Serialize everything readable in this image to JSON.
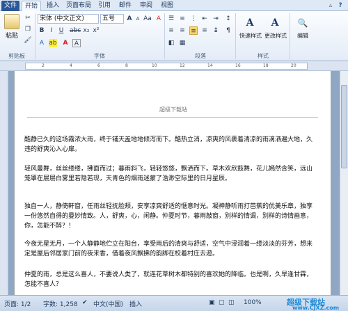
{
  "tabs": [
    "文件",
    "开始",
    "插入",
    "页面布局",
    "引用",
    "邮件",
    "审阅",
    "视图"
  ],
  "ribbon": {
    "paste_label": "粘贴",
    "clipboard_label": "剪贴板",
    "font_name": "宋体 (中文正文)",
    "font_size": "五号",
    "font_group_label": "字体",
    "paragraph_group_label": "段落",
    "styles_group_label": "样式",
    "quick_style_label": "快速样式",
    "change_style_label": "更改样式",
    "edit_label": "编辑"
  },
  "document": {
    "header": "超级下载站",
    "paragraphs": [
      "酷静已久的这场霧浓大雨，终于铺天盖地地倾泻而下。酷热立消，凉爽的风裹着清凉的雨滴洒遍大地，久违的舒爽沁入心扉。",
      "轻风曼舞，丝丝缕缕，拂面而过；暮雨斜飞，轻轻悠悠，飘洒而下。草木欢欣鼓舞，花儿嫣然含笑，远山笼罩在层层白雾里若隐若现，天青色的烟雨迷蒙了浩渺空际里的日月星辰。",
      "独自一人，静倚軒窗，任雨丝轻抚脸颊，安享凉爽舒适的惬意时光。凝神静听雨打芭蕉的优美乐章，独享一份悠然自得的曼妙情致。人，舒爽，心，闲静。仲夏时节，暮雨敲窗，别样的情调，别样的诗情画意，你，怎能不醉？！",
      "今夜无星无月，一个人静静地伫立在阳台，享受雨后的清爽与舒适，空气中浸润着一缕淡淡的芬芳，想来定是屋后邻居家门前的夜来香，借着夜风飘拂的韵脚在校着村庄去遊。",
      "仲夏的雨，总是这么喜人，不要说人类了，就连花草树木都特别的喜欢她的降临。也是啊，久旱逢甘霖，怎能不喜人？"
    ]
  },
  "status": {
    "page": "页面: 1/2",
    "words": "字数: 1,258",
    "lang": "中文(中国)",
    "mode": "插入",
    "zoom": "100%"
  },
  "watermark": {
    "line1": "超级下载站",
    "line2": "www.CJXZ.com"
  }
}
